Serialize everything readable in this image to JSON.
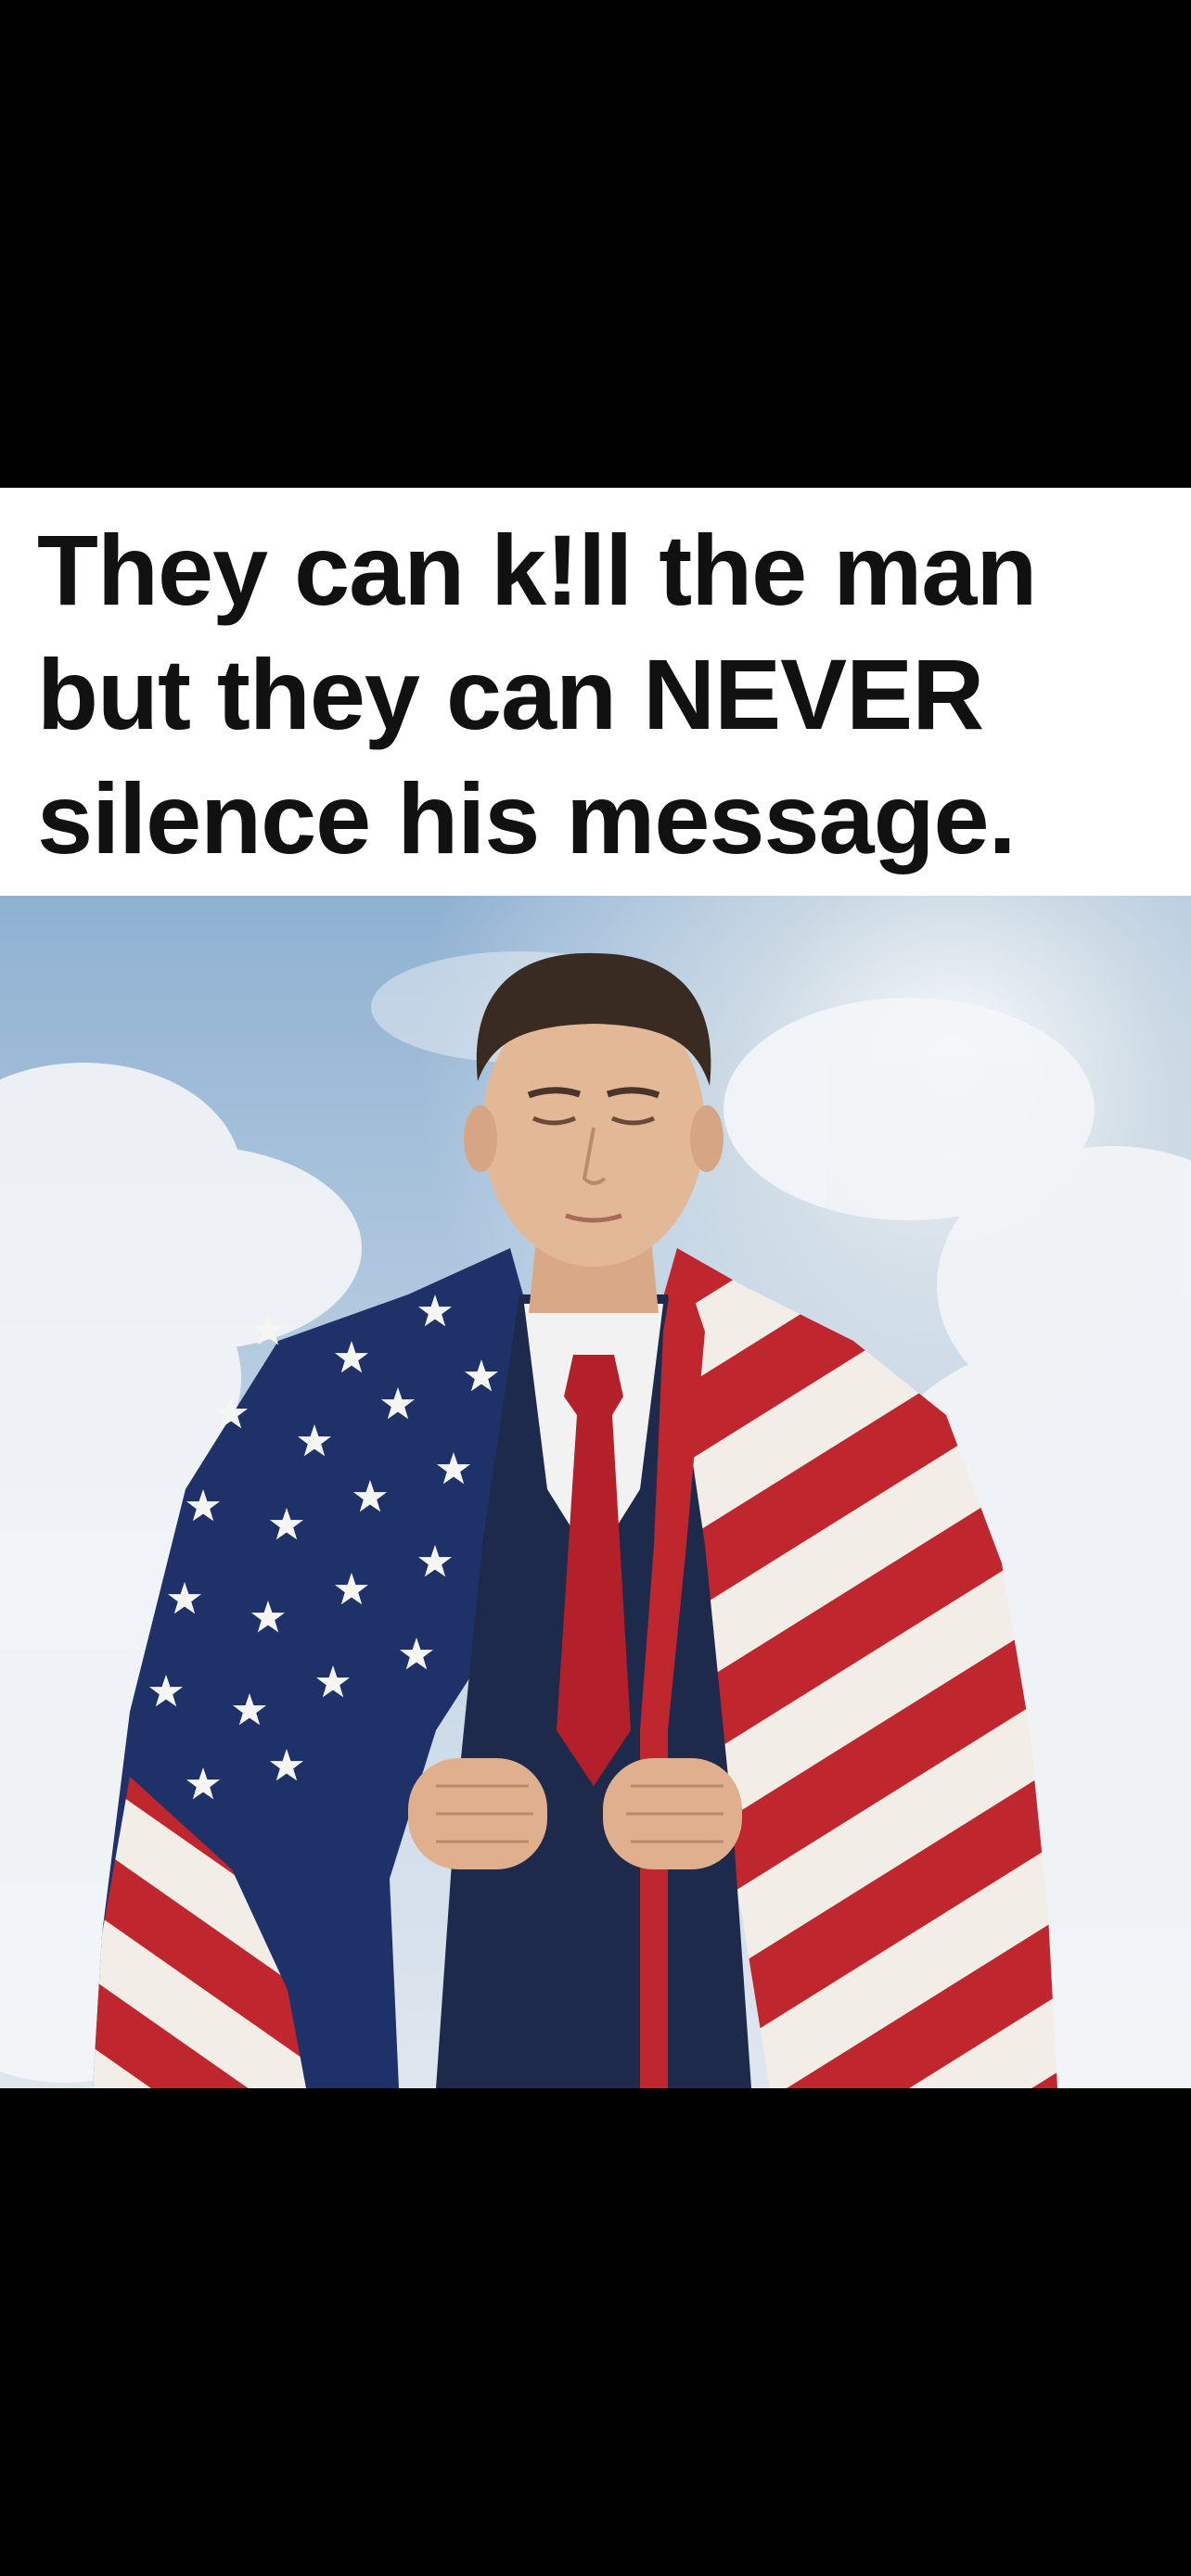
{
  "caption": {
    "lines": [
      "They can k!ll the man",
      "but they can NEVER",
      "silence his message."
    ]
  },
  "colors": {
    "background": "#000000",
    "caption_panel": "#ffffff",
    "caption_text": "#111111",
    "sky": "#a9c3dc",
    "flag_red": "#c0262d",
    "flag_white": "#f2ede6",
    "flag_blue": "#1f3169",
    "suit_navy": "#1e2a4c",
    "tie_red": "#b3202a",
    "skin": "#e3b897",
    "hair": "#3a2b22"
  },
  "photo": {
    "subject": "man-wrapped-in-american-flag-icon",
    "background": "clouds-sky-icon"
  }
}
